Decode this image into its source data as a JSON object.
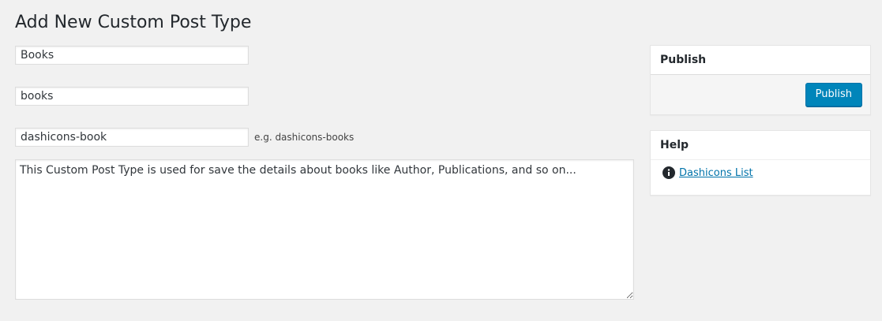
{
  "page": {
    "title": "Add New Custom Post Type"
  },
  "form": {
    "title_value": "Books",
    "slug_value": "books",
    "icon_value": "dashicons-book",
    "icon_hint": "e.g. dashicons-books",
    "description_value": "This Custom Post Type is used for save the details about books like Author, Publications, and so on..."
  },
  "publish_box": {
    "heading": "Publish",
    "button_label": "Publish"
  },
  "help_box": {
    "heading": "Help",
    "link_label": "Dashicons List",
    "icon": "info-icon"
  },
  "colors": {
    "background": "#f1f1f1",
    "primary_button": "#0085ba",
    "link": "#0073aa"
  }
}
